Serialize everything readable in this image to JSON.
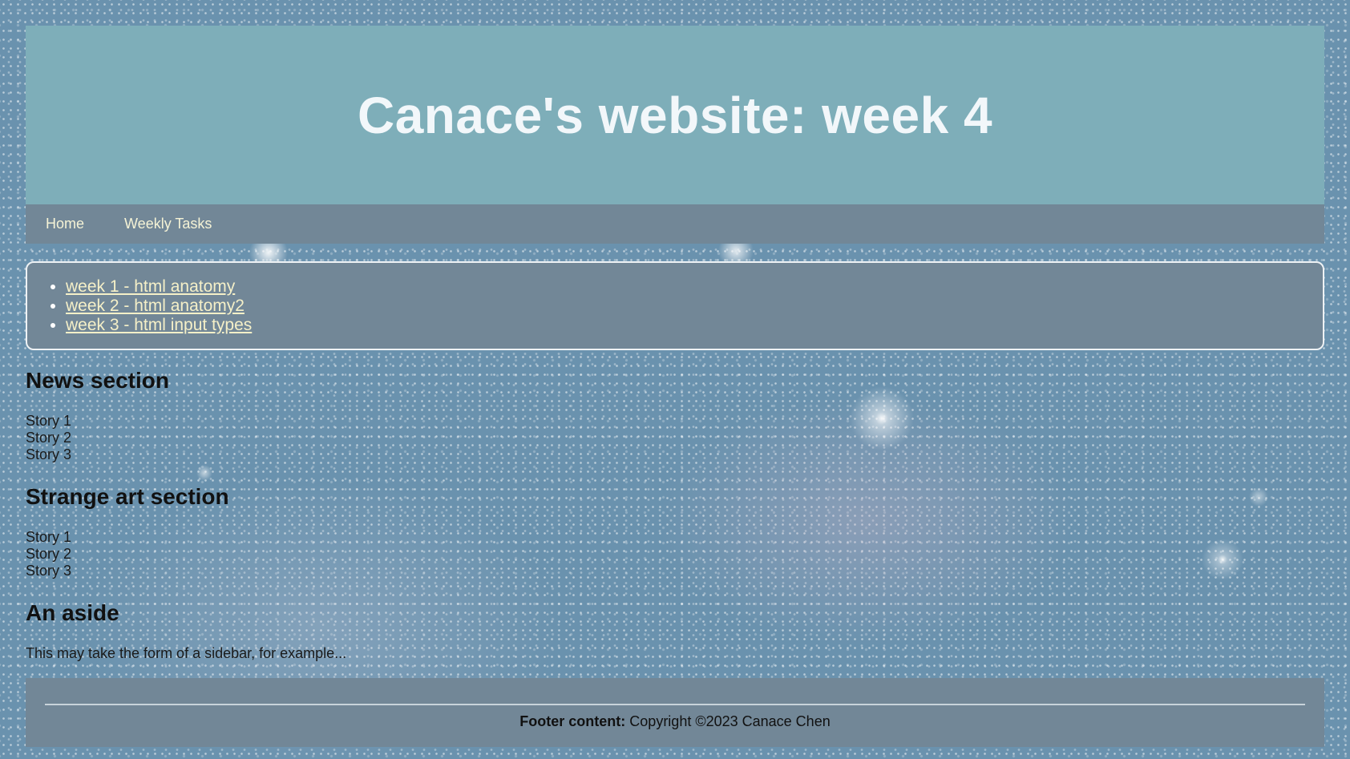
{
  "header": {
    "title": "Canace's website: week 4"
  },
  "nav": {
    "items": [
      {
        "label": "Home"
      },
      {
        "label": "Weekly Tasks"
      }
    ]
  },
  "tasks": {
    "links": [
      {
        "label": "week 1 - html anatomy"
      },
      {
        "label": "week 2 - html anatomy2"
      },
      {
        "label": "week 3 - html input types"
      }
    ]
  },
  "news": {
    "title": "News section",
    "stories": [
      "Story 1",
      "Story 2",
      "Story 3"
    ]
  },
  "art": {
    "title": "Strange art section",
    "stories": [
      "Story 1",
      "Story 2",
      "Story 3"
    ]
  },
  "aside": {
    "title": "An aside",
    "text": "This may take the form of a sidebar, for example..."
  },
  "footer": {
    "label": "Footer content:",
    "text": "Copyright ©2023 Canace Chen"
  },
  "colors": {
    "header_bg": "#7eaeb9",
    "nav_bg": "#728797",
    "link": "#f5f0c8"
  }
}
